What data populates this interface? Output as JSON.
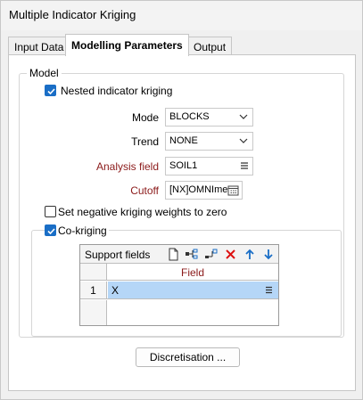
{
  "window": {
    "title": "Multiple Indicator Kriging"
  },
  "tabs": [
    {
      "label": "Input Data",
      "active": false
    },
    {
      "label": "Modelling Parameters",
      "active": true
    },
    {
      "label": "Output",
      "active": false
    }
  ],
  "model": {
    "group_label": "Model",
    "nested_indicator_kriging": {
      "label": "Nested indicator kriging",
      "checked": true
    },
    "mode": {
      "label": "Mode",
      "value": "BLOCKS"
    },
    "trend": {
      "label": "Trend",
      "value": "NONE"
    },
    "analysis_field": {
      "label": "Analysis field",
      "value": "SOIL1"
    },
    "cutoff": {
      "label": "Cutoff",
      "value": "[NX]OMNIme"
    },
    "negative_weights": {
      "label": "Set negative kriging weights to zero",
      "checked": false
    },
    "cokriging": {
      "label": "Co-kriging",
      "checked": true,
      "support_fields": {
        "toolbar_title": "Support fields",
        "column_header": "Field",
        "rows": [
          {
            "num": "1",
            "value": "X"
          }
        ]
      }
    }
  },
  "buttons": {
    "discretisation": "Discretisation ..."
  },
  "colors": {
    "accent": "#1a6ec6",
    "required_label": "#8b1a1a",
    "selection": "#b5d6f7"
  }
}
